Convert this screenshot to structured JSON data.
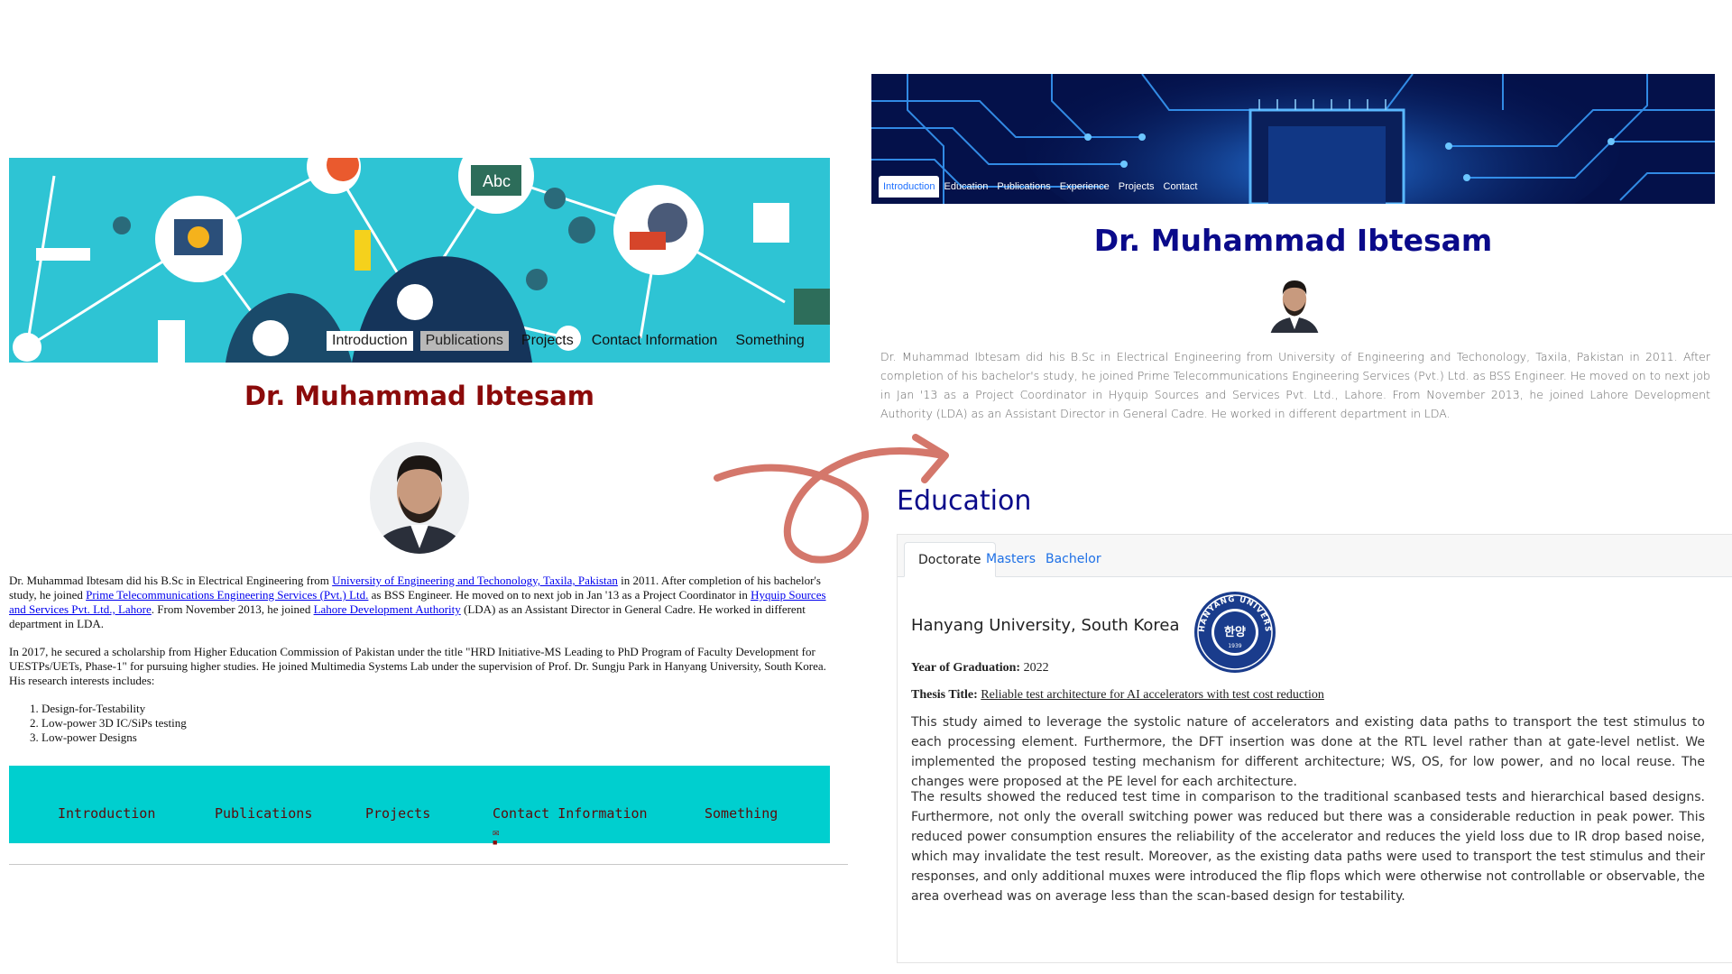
{
  "old_page": {
    "nav": [
      "Introduction",
      "Publications",
      "Projects",
      "Contact Information",
      "Something"
    ],
    "title": "Dr. Muhammad Ibtesam",
    "photo_icon": "portrait-photo",
    "intro": {
      "p1_a": "Dr. Muhammad Ibtesam did his B.Sc in Electrical Engineering from ",
      "link_uet": "University of Engineering and Techonology, Taxila, Pakistan",
      "p1_b": " in 2011. After completion of his bachelor's study, he joined ",
      "link_prime": "Prime Telecommunications Engineering Services (Pvt.) Ltd.",
      "p1_c": " as BSS Engineer. He moved on to next job in Jan '13 as a Project Coordinator in ",
      "link_hyquip": "Hyquip Sources and Services Pvt. Ltd., Lahore",
      "p1_d": ". From November 2013, he joined ",
      "link_lda": "Lahore Development Authority",
      "p1_e": " (LDA) as an Assistant Director in General Cadre. He worked in different department in LDA.",
      "p2": "In 2017, he secured a scholarship from Higher Education Commission of Pakistan under the title \"HRD Initiative-MS Leading to PhD Program of Faculty Development for UESTPs/UETs, Phase-1\" for pursuing higher studies. He joined Multimedia Systems Lab under the supervision of Prof. Dr. Sungju Park in Hanyang University, South Korea. His research interests includes:",
      "interests": [
        "Design-for-Testability",
        "Low-power 3D IC/SiPs testing",
        "Low-power Designs"
      ]
    },
    "footer": [
      "Introduction",
      "Publications",
      "Projects",
      "Contact Information",
      "Something"
    ],
    "footer_icons": [
      "mail-icon",
      "facebook-icon"
    ]
  },
  "new_page": {
    "nav": [
      "Introduction",
      "Education",
      "Publications",
      "Experience",
      "Projects",
      "Contact"
    ],
    "title": "Dr. Muhammad Ibtesam",
    "intro": "Dr. Muhammad Ibtesam did his B.Sc in Electrical Engineering from University of Engineering and Techonology, Taxila, Pakistan in 2011. After completion of his bachelor's study, he joined Prime Telecommunications Engineering Services (Pvt.) Ltd. as BSS Engineer. He moved on to next job in Jan '13 as a Project Coordinator in Hyquip Sources and Services Pvt. Ltd., Lahore. From November 2013, he joined Lahore Development Authority (LDA) as an Assistant Director in General Cadre. He worked in different department in LDA.",
    "education": {
      "heading": "Education",
      "tabs": [
        "Doctorate",
        "Masters",
        "Bachelor"
      ],
      "university": "Hanyang University, South Korea",
      "seal_text": "HANYANG UNIVERSITY",
      "seal_year": "1939",
      "seal_center": "한양",
      "year_label": "Year of Graduation:",
      "year": "2022",
      "thesis_label": "Thesis Title:",
      "thesis": "Reliable test architecture for AI accelerators with test cost reduction",
      "para1": "This study aimed to leverage the systolic nature of accelerators and existing data paths to transport the test stimulus to each processing element. Furthermore, the DFT insertion was done at the RTL level rather than at gate-level netlist. We implemented the proposed testing mechanism for different architecture; WS, OS, for low power, and no local reuse. The changes were proposed at the PE level for each architecture.",
      "para2": "The results showed the reduced test time in comparison to the traditional scanbased tests and hierarchical based designs. Furthermore, not only the overall switching power was reduced but there was a considerable reduction in peak power. This reduced power consumption ensures the reliability of the accelerator and reduces the yield loss due to IR drop based noise, which may invalidate the test result. Moreover, as the existing data paths were used to transport the test stimulus and their responses, and only additional muxes were introduced the flip flops which were otherwise not controllable or observable, the area overhead was on average less than the scan-based design for testability."
    }
  },
  "colors": {
    "old_banner": "#2ec4d4",
    "old_title": "#8b0a0a",
    "old_footer": "#00cfcf",
    "new_banner": "#04114a",
    "new_title": "#0a0a8a",
    "arrow": "#d4776b",
    "link_blue": "#1e70e6"
  }
}
